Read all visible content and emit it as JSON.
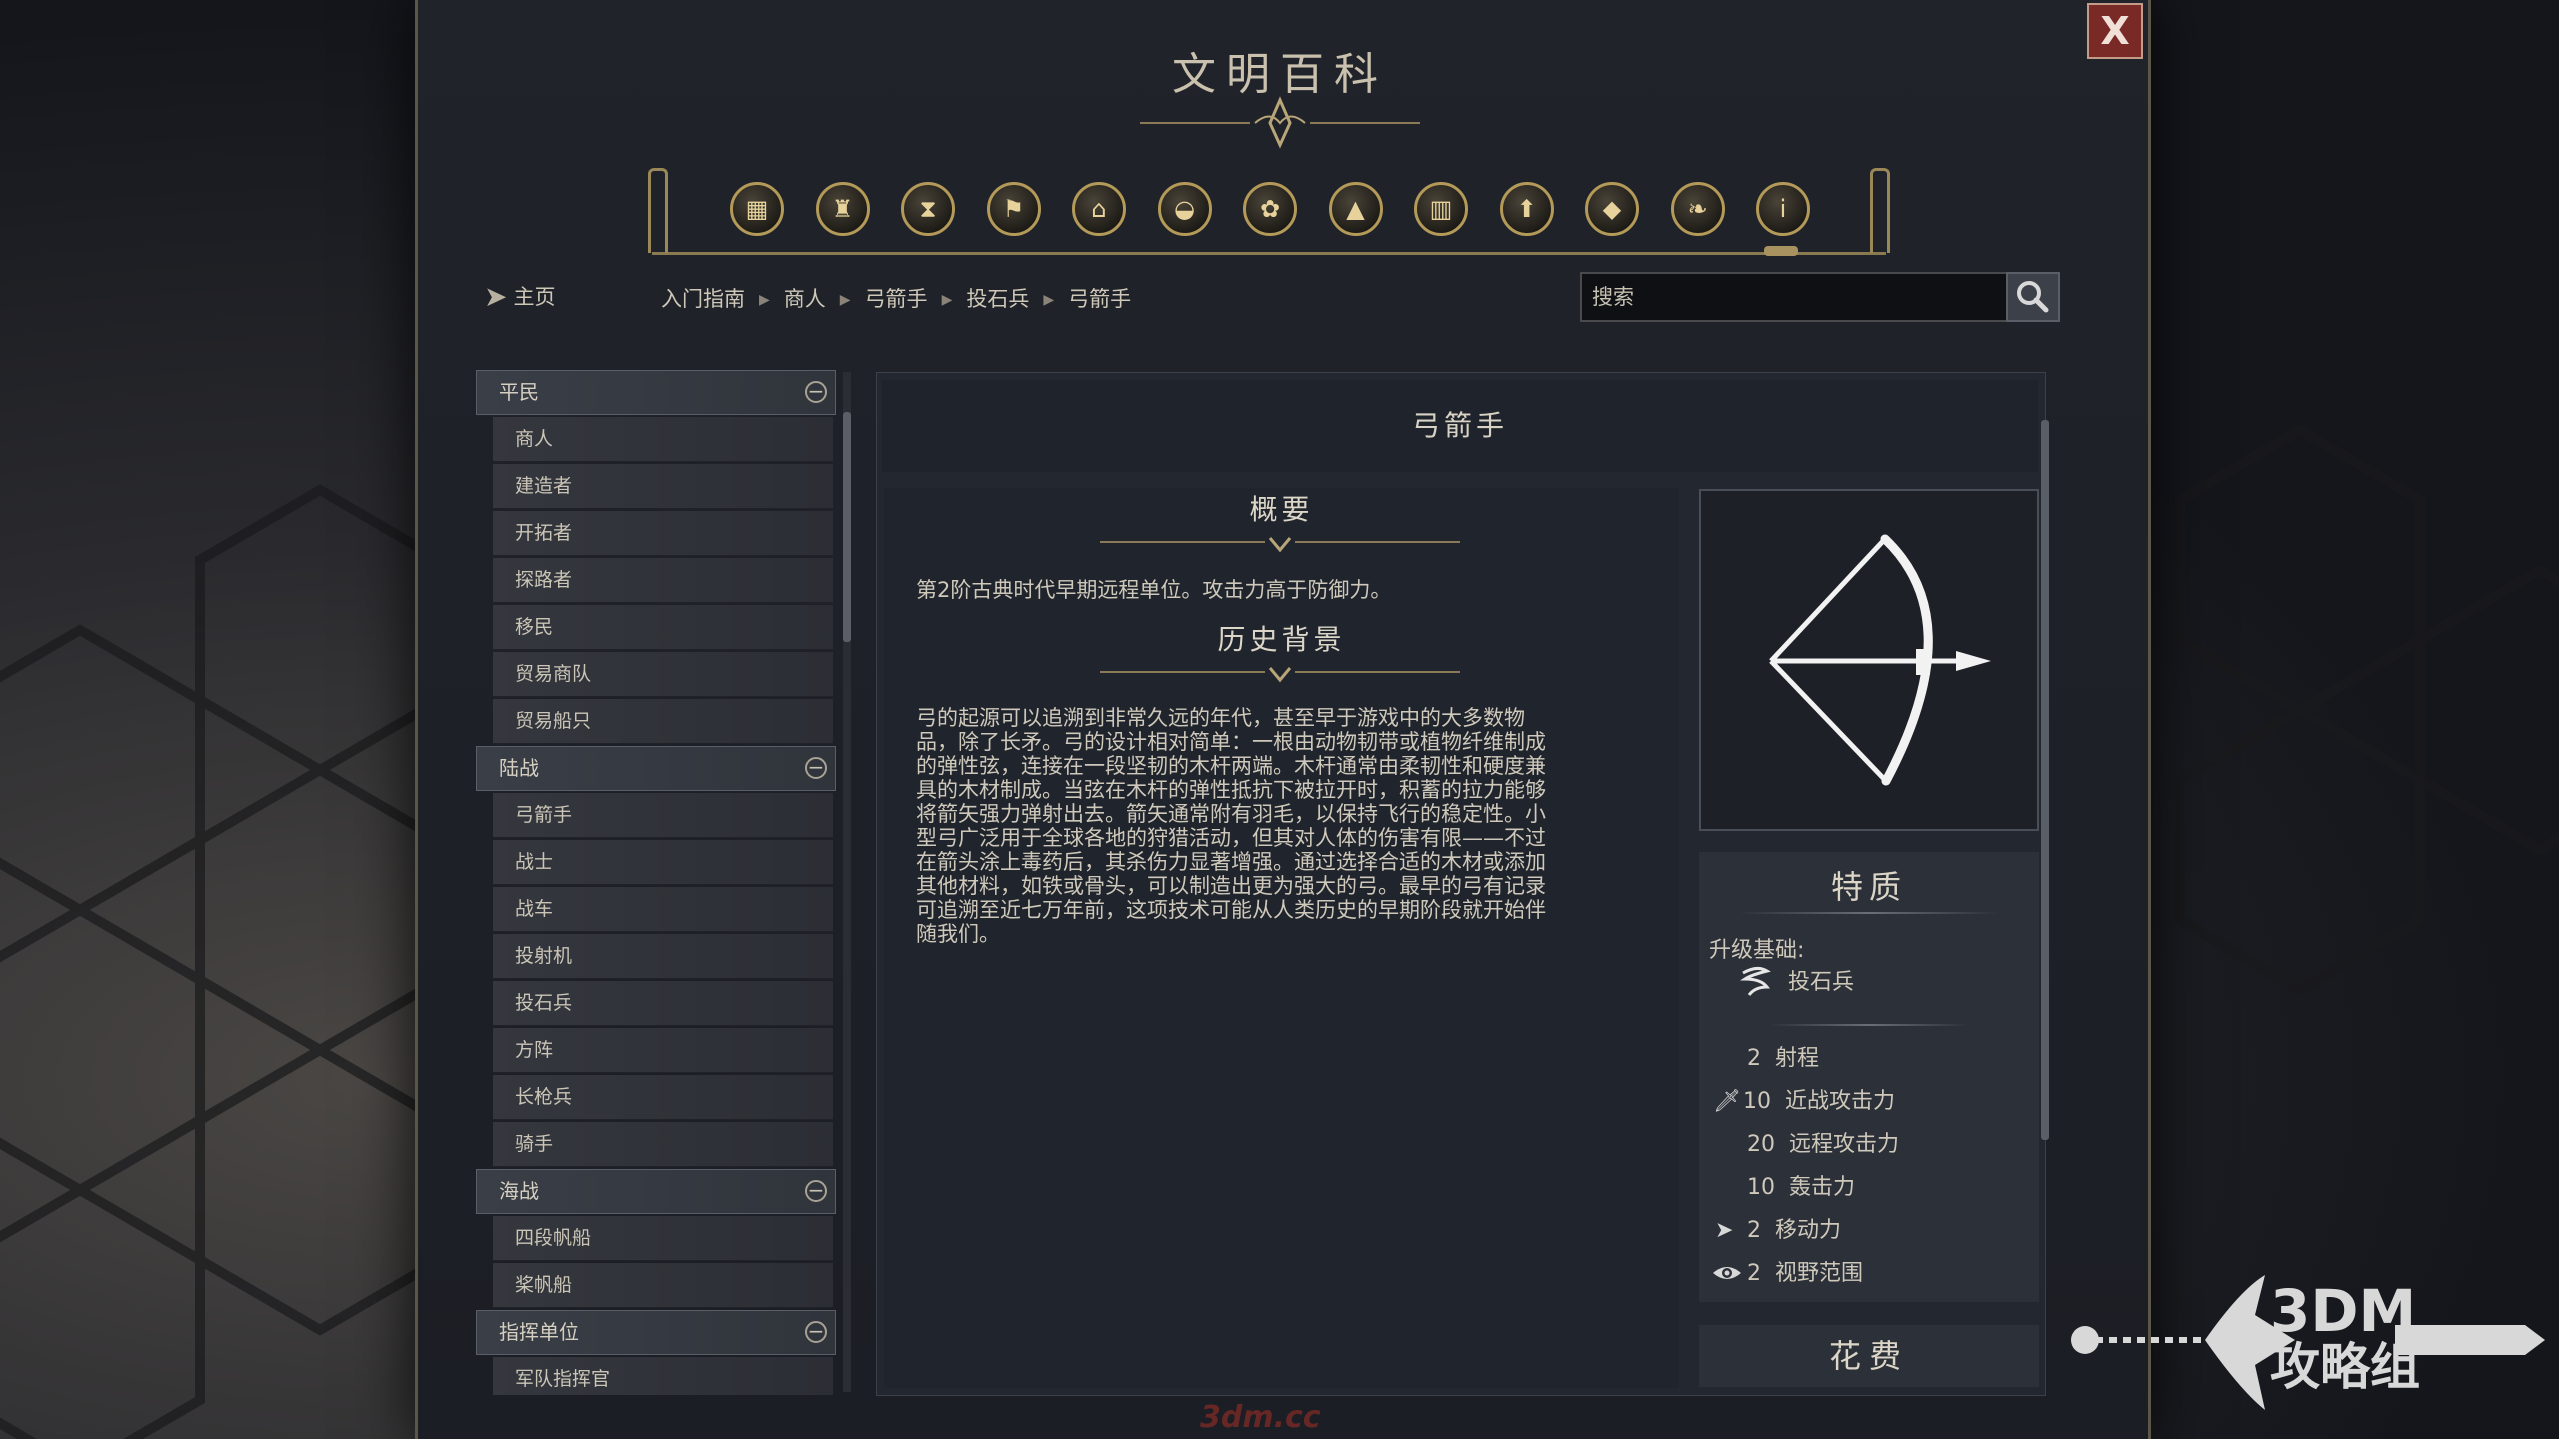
{
  "window": {
    "title": "文明百科",
    "close_label": "X"
  },
  "categories": [
    {
      "icon": "units-icon"
    },
    {
      "icon": "civics-icon"
    },
    {
      "icon": "era-hourglass-icon"
    },
    {
      "icon": "flag-icon"
    },
    {
      "icon": "building-icon"
    },
    {
      "icon": "resource-icon"
    },
    {
      "icon": "tech-icon"
    },
    {
      "icon": "terrain-icon"
    },
    {
      "icon": "district-icon"
    },
    {
      "icon": "upgrade-icon"
    },
    {
      "icon": "book-icon"
    },
    {
      "icon": "dove-icon"
    },
    {
      "icon": "info-icon"
    }
  ],
  "nav": {
    "home_label": "主页",
    "breadcrumbs": [
      "入门指南",
      "商人",
      "弓箭手",
      "投石兵",
      "弓箭手"
    ]
  },
  "search": {
    "placeholder": "搜索"
  },
  "sidebar": {
    "groups": [
      {
        "label": "平民",
        "items": [
          "商人",
          "建造者",
          "开拓者",
          "探路者",
          "移民",
          "贸易商队",
          "贸易船只"
        ]
      },
      {
        "label": "陆战",
        "items": [
          "弓箭手",
          "战士",
          "战车",
          "投射机",
          "投石兵",
          "方阵",
          "长枪兵",
          "骑手"
        ]
      },
      {
        "label": "海战",
        "items": [
          "四段帆船",
          "桨帆船"
        ]
      },
      {
        "label": "指挥单位",
        "items": [
          "军队指挥官"
        ]
      }
    ]
  },
  "article": {
    "title": "弓箭手",
    "overview_heading": "概要",
    "overview_text": "第2阶古典时代早期远程单位。攻击力高于防御力。",
    "history_heading": "历史背景",
    "history_lines": [
      "弓的起源可以追溯到非常久远的年代，甚至早于游戏中的大多数物",
      "品，除了长矛。弓的设计相对简单：一根由动物韧带或植物纤维制成",
      "的弹性弦，连接在一段坚韧的木杆两端。木杆通常由柔韧性和硬度兼",
      "具的木材制成。当弦在木杆的弹性抵抗下被拉开时，积蓄的拉力能够",
      "将箭矢强力弹射出去。箭矢通常附有羽毛，以保持飞行的稳定性。小",
      "型弓广泛用于全球各地的狩猎活动，但其对人体的伤害有限——不过",
      "在箭头涂上毒药后，其杀伤力显著增强。通过选择合适的木材或添加",
      "其他材料，如铁或骨头，可以制造出更为强大的弓。最早的弓有记录",
      "可追溯至近七万年前，这项技术可能从人类历史的早期阶段就开始伴",
      "随我们。"
    ]
  },
  "traits": {
    "heading": "特质",
    "upgrade_label": "升级基础:",
    "upgrade_from": "投石兵",
    "stats": [
      {
        "value": "2",
        "label": "射程",
        "icon": ""
      },
      {
        "value": "10",
        "label": "近战攻击力",
        "icon": "sword-icon"
      },
      {
        "value": "20",
        "label": "远程攻击力",
        "icon": ""
      },
      {
        "value": "10",
        "label": "轰击力",
        "icon": ""
      },
      {
        "value": "2",
        "label": "移动力",
        "icon": "movement-icon"
      },
      {
        "value": "2",
        "label": "视野范围",
        "icon": "eye-icon"
      }
    ]
  },
  "cost": {
    "heading": "花费"
  },
  "watermark": {
    "line1": "3DM",
    "line2": "攻略组",
    "site": "3dm.cc"
  },
  "colors": {
    "accent_gold": "#b39a58",
    "close_red": "#7a2a26",
    "panel_bg": "#20232a"
  }
}
